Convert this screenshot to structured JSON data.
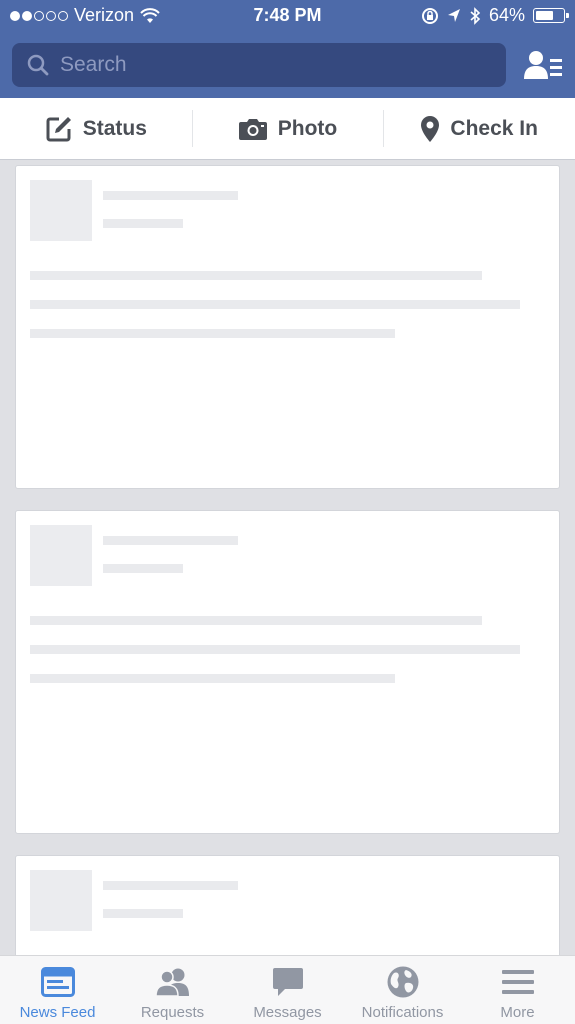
{
  "status_bar": {
    "carrier": "Verizon",
    "time": "7:48 PM",
    "battery": "64%",
    "battery_level": 0.64,
    "signal_bars": 2
  },
  "search": {
    "placeholder": "Search"
  },
  "composer": {
    "status": "Status",
    "photo": "Photo",
    "check_in": "Check In"
  },
  "tabs": [
    {
      "label": "News Feed",
      "icon": "news-feed-icon",
      "active": true
    },
    {
      "label": "Requests",
      "icon": "friends-icon",
      "active": false
    },
    {
      "label": "Messages",
      "icon": "message-icon",
      "active": false
    },
    {
      "label": "Notifications",
      "icon": "globe-icon",
      "active": false
    },
    {
      "label": "More",
      "icon": "menu-icon",
      "active": false
    }
  ],
  "colors": {
    "header": "#4d6aa9",
    "search_field": "#35497f",
    "active_tab": "#4a89dc",
    "inactive_tab": "#9197a3",
    "placeholder_bar": "#e9eaed"
  }
}
